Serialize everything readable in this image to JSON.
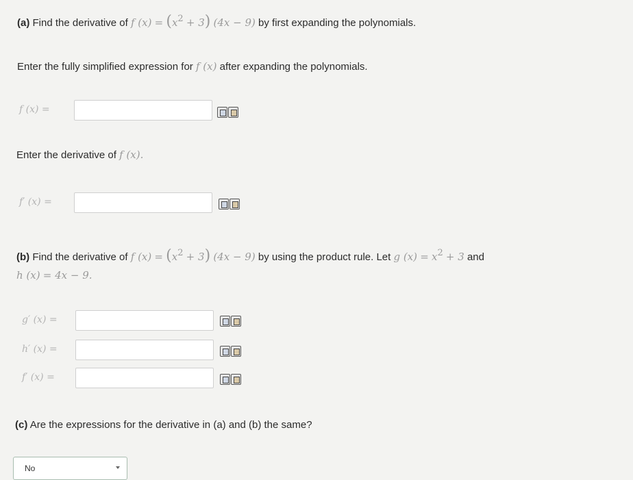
{
  "part_a": {
    "heading_prefix": "(a)",
    "heading_text_1": "Find the derivative of",
    "heading_text_2": "by first expanding the polynomials.",
    "instruction_1": "Enter the fully simplified expression for",
    "instruction_1_end": "after expanding the polynomials.",
    "instruction_2": "Enter the derivative of",
    "f_label": "f (x) =",
    "fprime_label": "f′ (x) ="
  },
  "part_b": {
    "heading_prefix": "(b)",
    "heading_text_1": "Find the derivative of",
    "heading_text_2": "by using the product rule. Let",
    "heading_text_3": "and",
    "gprime_label": "g′ (x) =",
    "hprime_label": "h′ (x) =",
    "fprime_label": "f′ (x) ="
  },
  "part_c": {
    "question_prefix": "(c)",
    "question_text": "Are the expressions for the derivative in (a) and (b) the same?",
    "select_value": "No"
  },
  "math": {
    "f_of_x": "f (x)",
    "eq": "=",
    "x": "x",
    "two": "2",
    "plus3": "+ 3",
    "factor2": "(4x − 9)",
    "g_of_x": "g (x)",
    "h_of_x": "h (x)",
    "h_def": "= 4x − 9.",
    "period": "."
  }
}
